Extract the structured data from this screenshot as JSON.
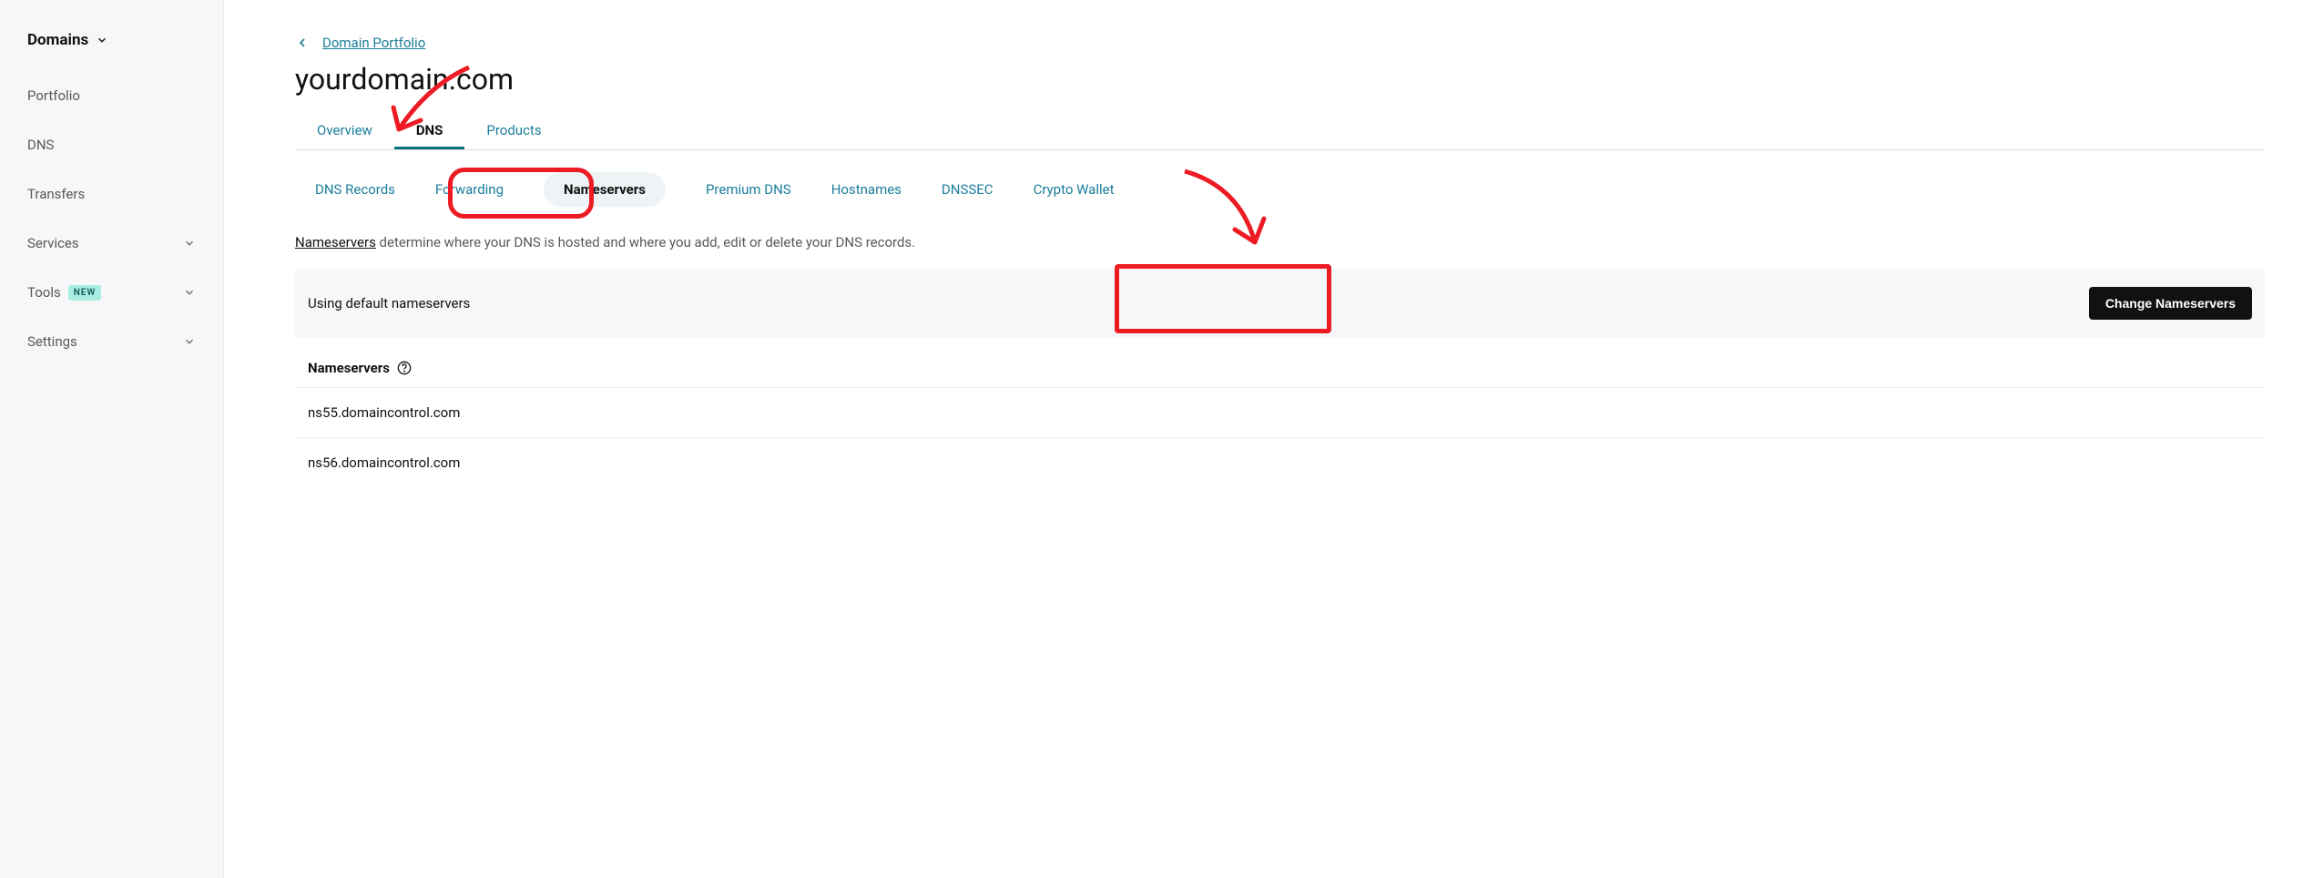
{
  "sidebar": {
    "header": "Domains",
    "items": [
      {
        "label": "Portfolio",
        "expandable": false,
        "badge": null
      },
      {
        "label": "DNS",
        "expandable": false,
        "badge": null
      },
      {
        "label": "Transfers",
        "expandable": false,
        "badge": null
      },
      {
        "label": "Services",
        "expandable": true,
        "badge": null
      },
      {
        "label": "Tools",
        "expandable": true,
        "badge": "NEW"
      },
      {
        "label": "Settings",
        "expandable": true,
        "badge": null
      }
    ]
  },
  "breadcrumb": {
    "label": "Domain Portfolio"
  },
  "domainTitle": "yourdomain.com",
  "tabs": {
    "main": [
      {
        "label": "Overview",
        "active": false
      },
      {
        "label": "DNS",
        "active": true
      },
      {
        "label": "Products",
        "active": false
      }
    ],
    "sub": [
      {
        "label": "DNS Records",
        "active": false
      },
      {
        "label": "Forwarding",
        "active": false
      },
      {
        "label": "Nameservers",
        "active": true
      },
      {
        "label": "Premium DNS",
        "active": false
      },
      {
        "label": "Hostnames",
        "active": false
      },
      {
        "label": "DNSSEC",
        "active": false
      },
      {
        "label": "Crypto Wallet",
        "active": false
      }
    ]
  },
  "description": {
    "linkText": "Nameservers",
    "rest": " determine where your DNS is hosted and where you add, edit or delete your DNS records."
  },
  "statusPanel": {
    "text": "Using default nameservers",
    "button": "Change Nameservers"
  },
  "nsSection": {
    "title": "Nameservers",
    "rows": [
      "ns55.domaincontrol.com",
      "ns56.domaincontrol.com"
    ]
  }
}
